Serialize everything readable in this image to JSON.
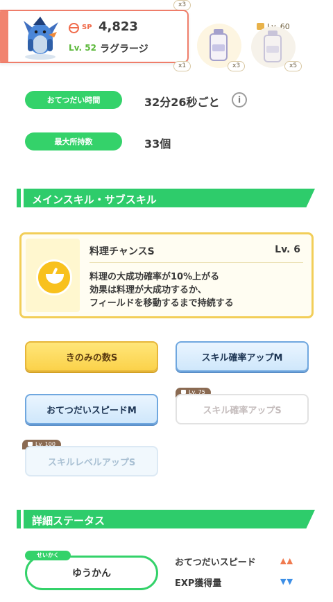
{
  "top": {
    "sp_label": "SP",
    "sp_value": "4,823",
    "level": "Lv. 52",
    "pokemon_name": "ラグラージ",
    "bubble_counts": [
      "x3",
      "x1",
      "x3",
      "x5"
    ],
    "locked_ingredient_level": "Lv. 60"
  },
  "info": {
    "help_time_label": "おてつだい時間",
    "help_time_value": "32分26秒ごと",
    "info_icon": "i",
    "max_carry_label": "最大所持数",
    "max_carry_value": "33個"
  },
  "skills_section": {
    "title": "メインスキル・サブスキル"
  },
  "main_skill": {
    "name": "料理チャンスS",
    "level": "Lv. 6",
    "desc_line1": "料理の大成功確率が10%上がる",
    "desc_line2": "効果は料理が大成功するか、",
    "desc_line3": "フィールドを移動するまで持続する"
  },
  "sub_skills": [
    {
      "label": "きのみの数S",
      "style": "gold",
      "locked": false
    },
    {
      "label": "スキル確率アップM",
      "style": "blue",
      "locked": false
    },
    {
      "label": "おてつだいスピードM",
      "style": "blue",
      "locked": false
    },
    {
      "label": "スキル確率アップS",
      "style": "locked-white",
      "locked": true,
      "unlock_level": "Lv. 75"
    },
    {
      "label": "スキルレベルアップS",
      "style": "locked-blue",
      "locked": true,
      "unlock_level": "Lv. 100"
    }
  ],
  "status_section": {
    "title": "詳細ステータス",
    "nature_tag": "せいかく",
    "nature": "ゆうかん",
    "stat_up_label": "おてつだいスピード",
    "stat_up_arrows": "▲▲",
    "stat_down_label": "EXP獲得量",
    "stat_down_arrows": "▼▼"
  },
  "colors": {
    "accent_green": "#2ecc6b",
    "card_border": "#ef7d6a",
    "skill_gold": "#f8c11e",
    "up_arrow": "#f07a4f",
    "down_arrow": "#3d8fe6"
  }
}
